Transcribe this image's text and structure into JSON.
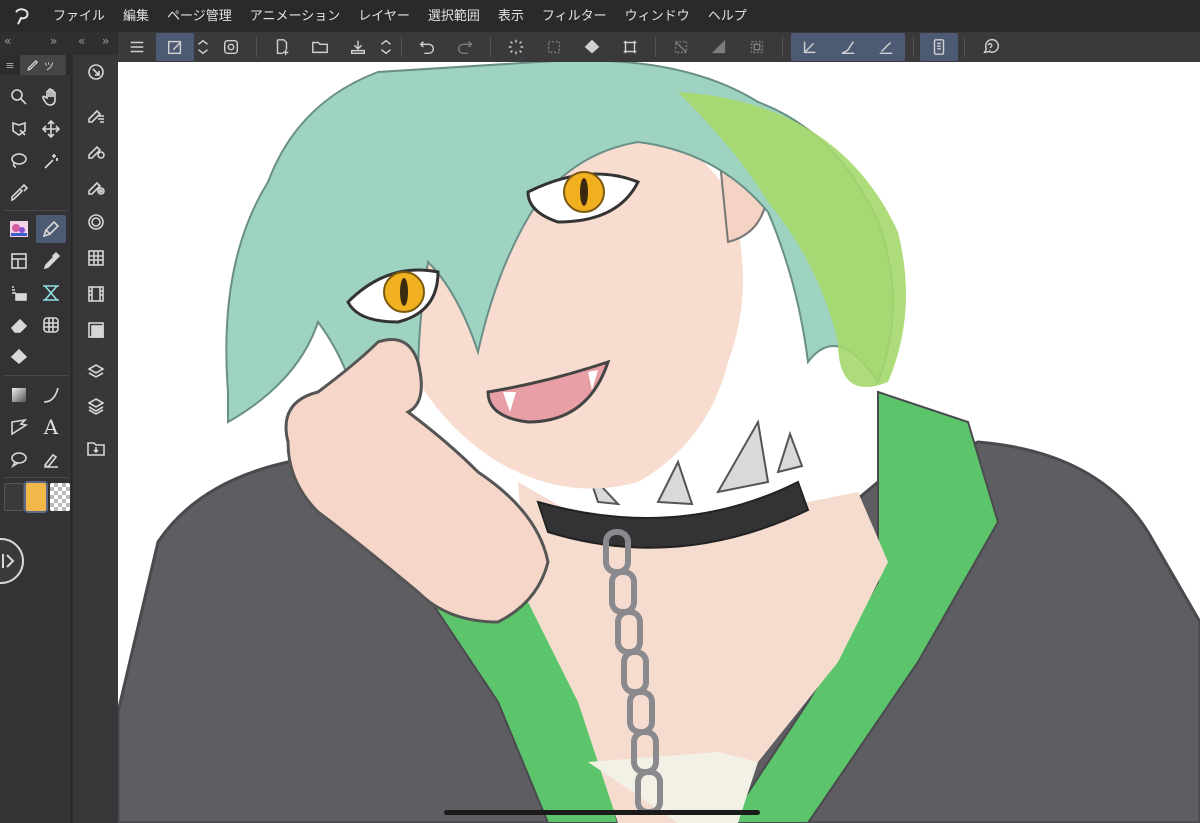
{
  "menu": {
    "items": [
      "ファイル",
      "編集",
      "ページ管理",
      "アニメーション",
      "レイヤー",
      "選択範囲",
      "表示",
      "フィルター",
      "ウィンドウ",
      "ヘルプ"
    ]
  },
  "tool_palette": {
    "tab_label": "ツ",
    "tools": [
      {
        "name": "zoom-icon"
      },
      {
        "name": "hand-icon"
      },
      {
        "name": "object-select-icon"
      },
      {
        "name": "move-layer-icon"
      },
      {
        "name": "lasso-icon"
      },
      {
        "name": "magic-wand-icon"
      },
      {
        "name": "eyedropper-icon"
      },
      {
        "name": "sub-tool-thumb-icon"
      },
      {
        "name": "pen-icon"
      },
      {
        "name": "frame-icon"
      },
      {
        "name": "airbrush-icon"
      },
      {
        "name": "decoration-icon"
      },
      {
        "name": "ruler-icon"
      },
      {
        "name": "eraser-icon"
      },
      {
        "name": "perspective-grid-icon"
      },
      {
        "name": "fill-icon"
      },
      {
        "name": "gradient-icon"
      },
      {
        "name": "curve-icon"
      },
      {
        "name": "figure-icon"
      },
      {
        "name": "text-icon"
      },
      {
        "name": "balloon-icon"
      },
      {
        "name": "correct-line-icon"
      }
    ],
    "text_tool_glyph": "A",
    "colors": {
      "main": "#3a3a3c",
      "sub": "#f2b94a",
      "transparent": "checker"
    }
  },
  "colors": {
    "accent_selected": "#4d5a73",
    "hair_primary": "#9fd4c0",
    "hair_secondary": "#a7d86a",
    "hoodie": "#5a5a5e",
    "hoodie_lining": "#55c26a",
    "skin": "#f6d9cc",
    "eye": "#f0b020"
  }
}
